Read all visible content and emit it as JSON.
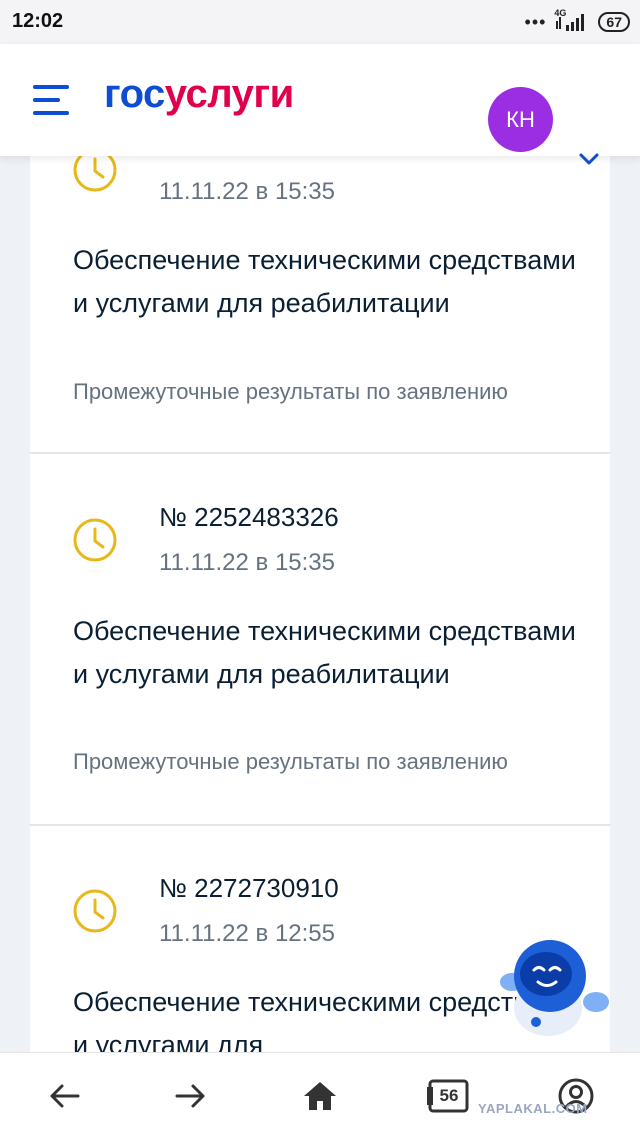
{
  "status_bar": {
    "time": "12:02",
    "dots": "•••",
    "network": "4G",
    "battery": "67"
  },
  "header": {
    "logo_part1": "гос",
    "logo_part2": "услуги",
    "avatar_initials": "КН",
    "colors": {
      "brand_blue": "#0d4cd3",
      "brand_red": "#e0004d",
      "avatar": "#9b2ee3"
    }
  },
  "applications": [
    {
      "number": "",
      "date": "11.11.22 в 15:35",
      "title": "Обеспечение техническими средствами и услугами для реабилитации",
      "status": "Промежуточные результаты по заявлению",
      "icon": "clock-icon"
    },
    {
      "number": "№ 2252483326",
      "date": "11.11.22 в 15:35",
      "title": "Обеспечение техническими средствами и услугами для реабилитации",
      "status": "Промежуточные результаты по заявлению",
      "icon": "clock-icon"
    },
    {
      "number": "№ 2272730910",
      "date": "11.11.22 в 12:55",
      "title": "Обеспечение техническими средствами и услугами для",
      "status": "",
      "icon": "clock-icon"
    }
  ],
  "bottom_nav": {
    "back_icon": "arrow-left-icon",
    "forward_icon": "arrow-right-icon",
    "home_icon": "home-icon",
    "tabs_count": "56",
    "profile_icon": "profile-icon"
  },
  "watermark": "YAPLAKAL.COM"
}
